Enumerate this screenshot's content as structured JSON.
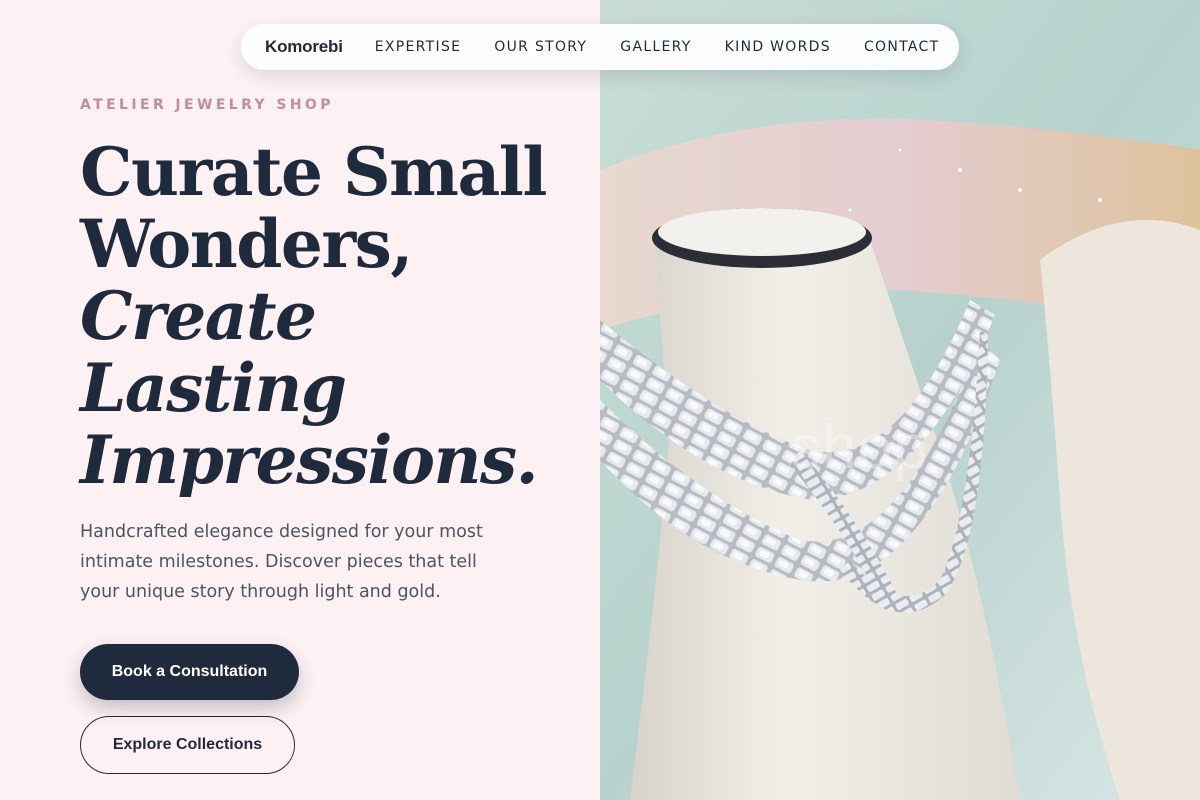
{
  "nav": {
    "brand": "Komorebi",
    "items": [
      "EXPERTISE",
      "OUR STORY",
      "GALLERY",
      "KIND WORDS",
      "CONTACT"
    ]
  },
  "hero": {
    "eyebrow": "ATELIER JEWELRY SHOP",
    "headline": [
      "Curate Small",
      "Wonders,",
      "Create",
      "Lasting",
      "Impressions."
    ],
    "description": "Handcrafted elegance designed for your most intimate milestones. Discover pieces that tell your unique story through light and gold.",
    "primary_button": "Book a Consultation",
    "secondary_button": "Explore Collections"
  },
  "image": {
    "subject": "silver cuban link necklaces on white display bust",
    "watermark": "shop"
  },
  "colors": {
    "navy": "#1f2a3c",
    "blush_bg": "#fdf1f3",
    "eyebrow": "#c08e9c",
    "body_text": "#4b5565"
  }
}
